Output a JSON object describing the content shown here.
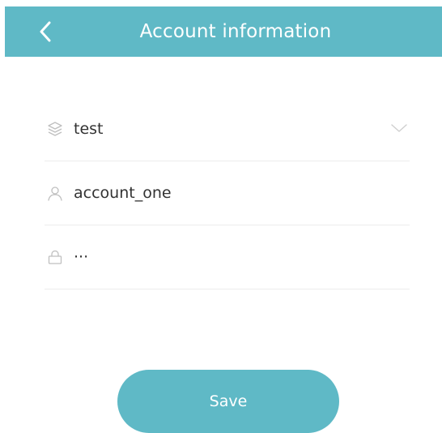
{
  "header": {
    "title": "Account information",
    "back_icon": "chevron-left-icon"
  },
  "form": {
    "group": {
      "icon": "layers-icon",
      "value": "test",
      "dropdown_icon": "chevron-down-icon"
    },
    "account": {
      "icon": "user-icon",
      "value": "account_one"
    },
    "password": {
      "icon": "lock-icon",
      "value": "···"
    }
  },
  "actions": {
    "save_label": "Save"
  },
  "colors": {
    "accent": "#5fb9c6",
    "text": "#333333",
    "icon": "#bfbfbf",
    "divider": "#ececec"
  }
}
